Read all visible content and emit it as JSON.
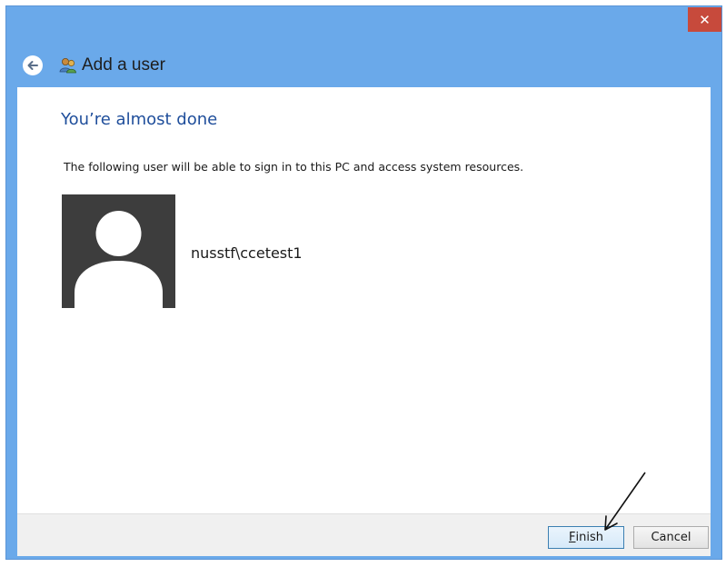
{
  "window": {
    "title": "Add a user",
    "close_label": "✕",
    "frame_color": "#6aa9ea",
    "close_color": "#c74a3c"
  },
  "icons": {
    "back": "back-arrow-icon",
    "users": "users-icon",
    "close": "close-icon",
    "avatar": "default-user-avatar"
  },
  "main": {
    "heading": "You’re almost done",
    "description": "The following user will be able to sign in to this PC and access system resources.",
    "user_name": "nusstf\\ccetest1",
    "heading_color": "#1f4e9b"
  },
  "footer": {
    "finish_accesskey": "F",
    "finish_rest": "inish",
    "cancel_label": "Cancel"
  }
}
